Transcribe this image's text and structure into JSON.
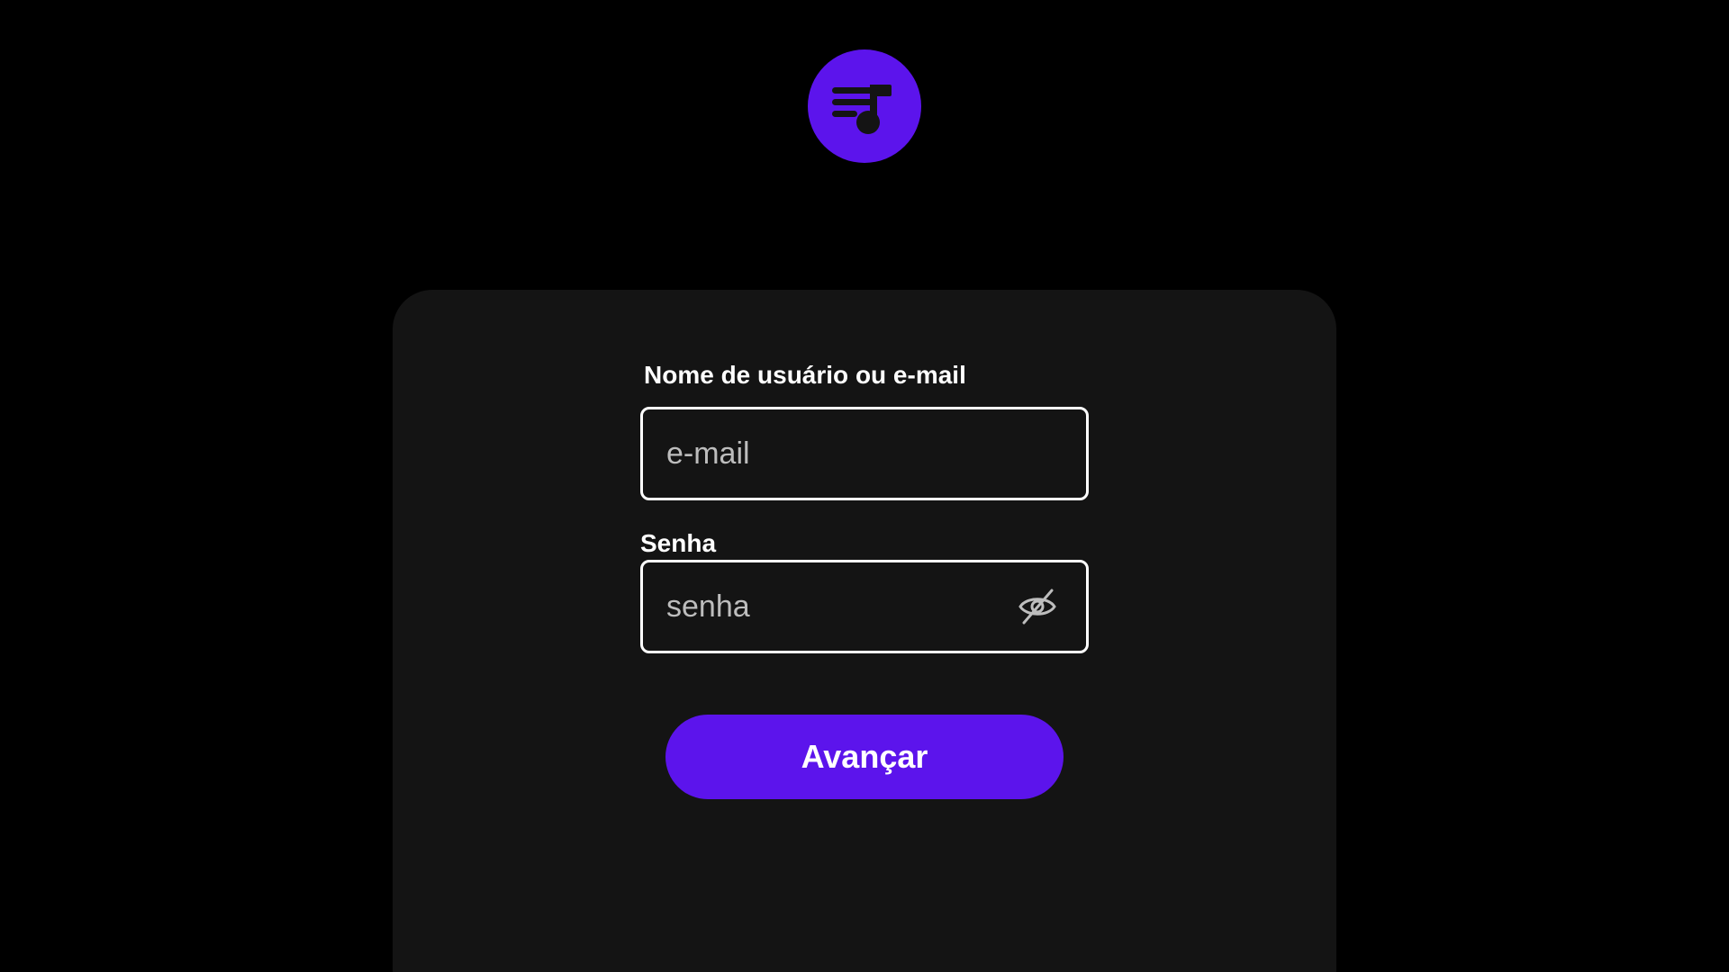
{
  "colors": {
    "accent": "#5c14ec",
    "background": "#000000",
    "card": "#141414",
    "input_border": "#ffffff",
    "placeholder": "#bdbdbd",
    "icon": "#bdbdbd"
  },
  "logo": {
    "icon": "music-playlist-icon"
  },
  "form": {
    "username": {
      "label": "Nome de usuário ou e-mail",
      "placeholder": "e-mail",
      "value": ""
    },
    "password": {
      "label": "Senha",
      "placeholder": "senha",
      "value": "",
      "toggle_icon": "eye-slash-icon"
    },
    "submit_label": "Avançar"
  }
}
